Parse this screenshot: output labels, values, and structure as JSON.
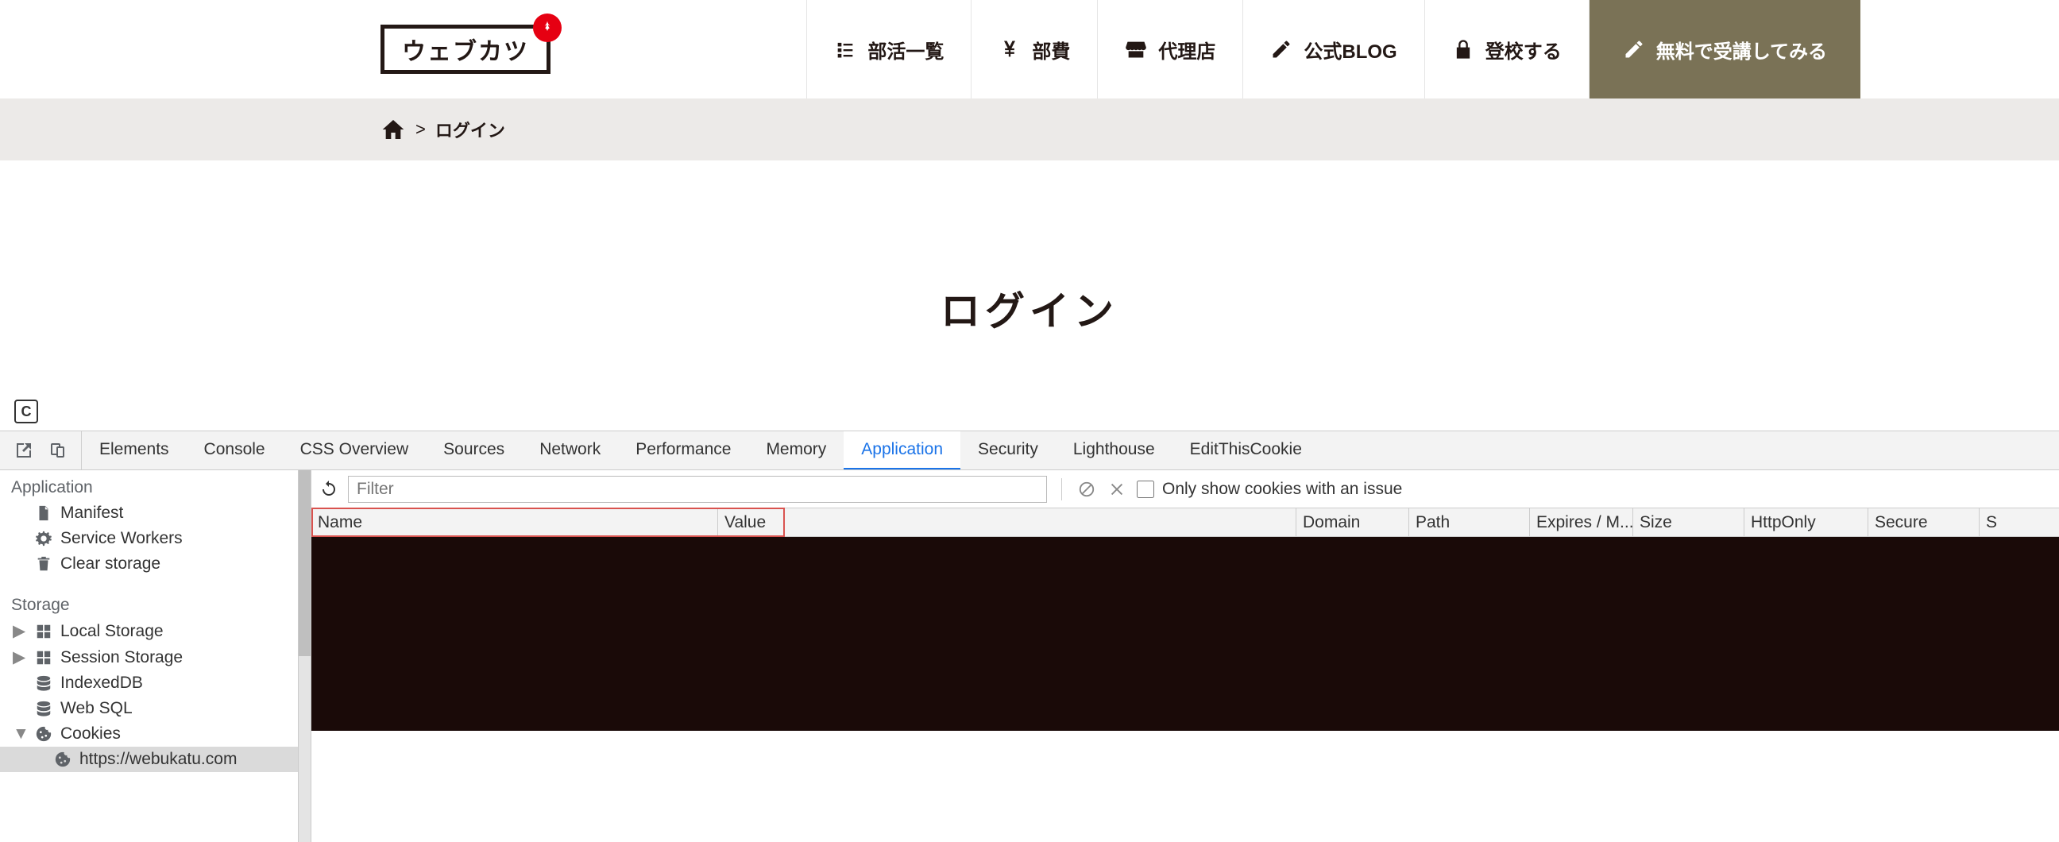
{
  "site": {
    "logo_text": "ウェブカツ",
    "nav": [
      {
        "icon": "list",
        "label": "部活一覧"
      },
      {
        "icon": "yen",
        "label": "部費"
      },
      {
        "icon": "shop",
        "label": "代理店"
      },
      {
        "icon": "pen",
        "label": "公式BLOG"
      },
      {
        "icon": "lock",
        "label": "登校する"
      }
    ],
    "cta": {
      "icon": "pencil",
      "label": "無料で受講してみる"
    },
    "breadcrumb": {
      "sep": ">",
      "current": "ログイン"
    },
    "page_title": "ログイン"
  },
  "devtools": {
    "tabs": [
      "Elements",
      "Console",
      "CSS Overview",
      "Sources",
      "Network",
      "Performance",
      "Memory",
      "Application",
      "Security",
      "Lighthouse",
      "EditThisCookie"
    ],
    "active_tab": "Application",
    "sidebar": {
      "section_app": "Application",
      "item_manifest": "Manifest",
      "item_sw": "Service Workers",
      "item_clear": "Clear storage",
      "section_storage": "Storage",
      "item_local": "Local Storage",
      "item_session": "Session Storage",
      "item_idb": "IndexedDB",
      "item_websql": "Web SQL",
      "item_cookies": "Cookies",
      "item_cookie_site": "https://webukatu.com"
    },
    "toolbar": {
      "filter_placeholder": "Filter",
      "only_issues": "Only show cookies with an issue"
    },
    "columns": {
      "name": "Name",
      "value": "Value",
      "domain": "Domain",
      "path": "Path",
      "expires": "Expires / M...",
      "size": "Size",
      "httponly": "HttpOnly",
      "secure": "Secure",
      "samesite": "S"
    }
  }
}
